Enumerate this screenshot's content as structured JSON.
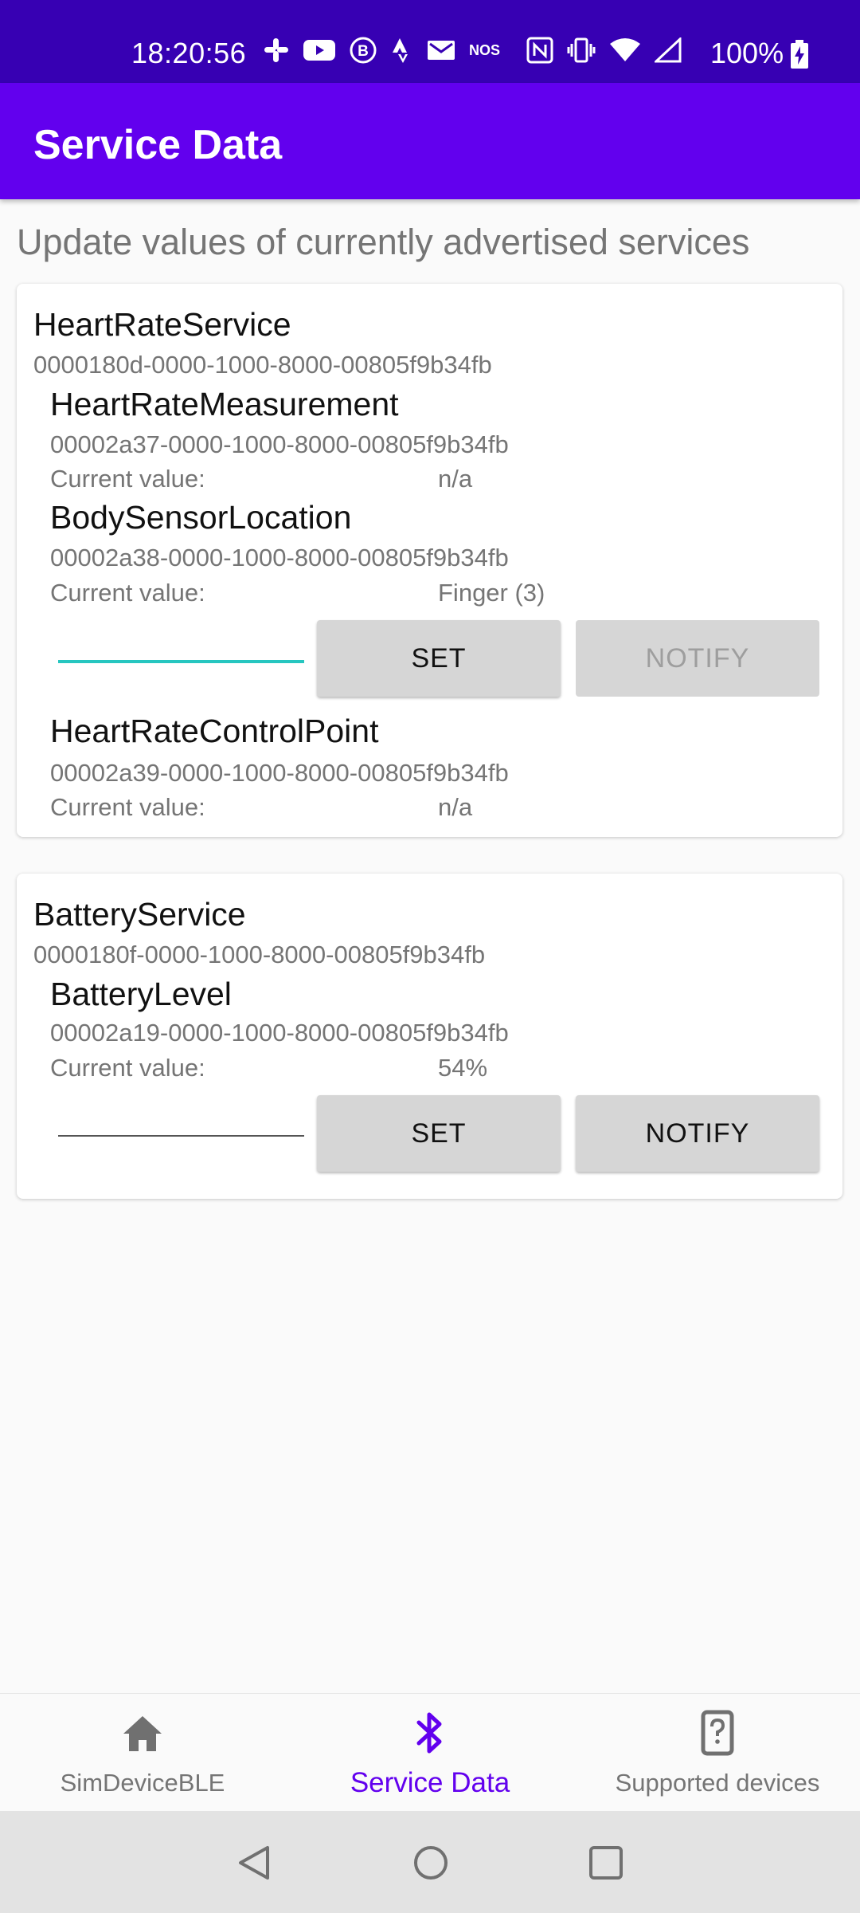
{
  "status_bar": {
    "time": "18:20:56",
    "battery": "100%",
    "icons": [
      "slack-icon",
      "youtube-icon",
      "b-circle-icon",
      "strava-icon",
      "gmail-icon",
      "nos-icon",
      "nfc-icon",
      "vibrate-icon",
      "wifi-icon",
      "signal-icon",
      "battery-charging-icon"
    ],
    "nos_text": "NOS"
  },
  "app_bar": {
    "title": "Service Data"
  },
  "page": {
    "subtitle": "Update values of currently advertised services"
  },
  "services": [
    {
      "name": "HeartRateService",
      "uuid": "0000180d-0000-1000-8000-00805f9b34fb",
      "characteristics": [
        {
          "name": "HeartRateMeasurement",
          "uuid": "00002a37-0000-1000-8000-00805f9b34fb",
          "label": "Current value:",
          "value": "n/a"
        },
        {
          "name": "BodySensorLocation",
          "uuid": "00002a38-0000-1000-8000-00805f9b34fb",
          "label": "Current value:",
          "value": "Finger (3)",
          "input_value": "",
          "set_label": "SET",
          "notify_label": "NOTIFY",
          "notify_enabled": false
        },
        {
          "name": "HeartRateControlPoint",
          "uuid": "00002a39-0000-1000-8000-00805f9b34fb",
          "label": "Current value:",
          "value": "n/a"
        }
      ]
    },
    {
      "name": "BatteryService",
      "uuid": "0000180f-0000-1000-8000-00805f9b34fb",
      "characteristics": [
        {
          "name": "BatteryLevel",
          "uuid": "00002a19-0000-1000-8000-00805f9b34fb",
          "label": "Current value:",
          "value": "54%",
          "input_value": "",
          "set_label": "SET",
          "notify_label": "NOTIFY",
          "notify_enabled": true
        }
      ]
    }
  ],
  "bottom_nav": {
    "items": [
      {
        "label": "SimDeviceBLE",
        "icon": "home-icon",
        "active": false
      },
      {
        "label": "Service Data",
        "icon": "bluetooth-icon",
        "active": true
      },
      {
        "label": "Supported devices",
        "icon": "device-unknown-icon",
        "active": false
      }
    ]
  },
  "colors": {
    "status_bar": "#3700b3",
    "app_bar": "#6200ee",
    "accent": "#6200ee",
    "input_focus": "#26c6c0",
    "button_bg": "#d6d6d6"
  }
}
